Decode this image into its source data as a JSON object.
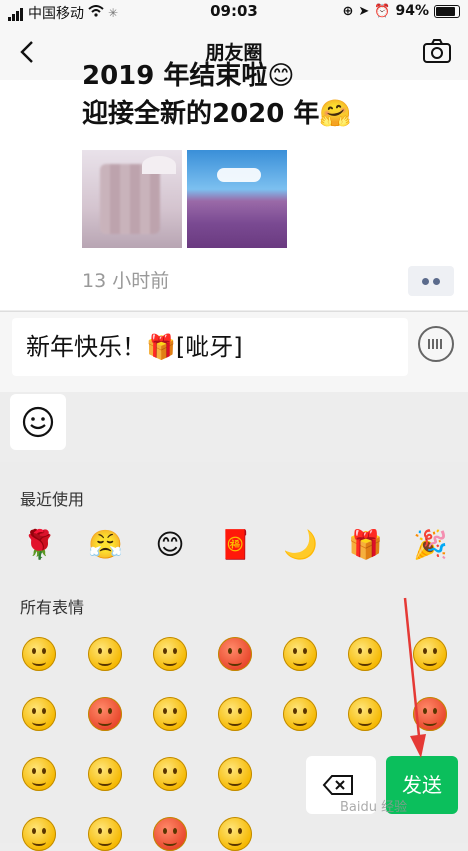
{
  "status_bar": {
    "carrier": "中国移动",
    "time": "09:03",
    "battery": "94%"
  },
  "nav": {
    "title": "朋友圈",
    "back_icon": "chevron-left-icon",
    "camera_icon": "camera-icon"
  },
  "post": {
    "text_line1": "2019 年结束啦😊",
    "text_line2": "迎接全新的2020 年🤗",
    "time": "13 小时前"
  },
  "comment_input": {
    "value": "新年快乐！🎁[呲牙]"
  },
  "emoji_panel": {
    "recent_label": "最近使用",
    "all_label": "所有表情",
    "recent": [
      "🌹",
      "😤",
      "😊",
      "🧧",
      "🌙",
      "🎁",
      "🎉"
    ]
  },
  "actions": {
    "send_label": "发送",
    "delete_icon": "backspace-icon"
  },
  "watermark": "Baidu 经验",
  "colors": {
    "send": "#0bbf5c",
    "arrow": "#e53935",
    "emoji": "#f5b800"
  }
}
